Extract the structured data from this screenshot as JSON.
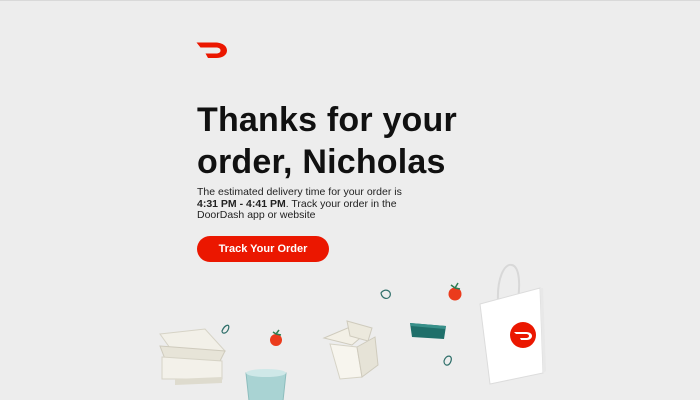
{
  "brand": {
    "logo_icon": "doordash-logo-icon",
    "accent_color": "#eb1700"
  },
  "email": {
    "headline": "Thanks for your order, Nicholas",
    "body_prefix": "The estimated delivery time for your order is ",
    "delivery_window": "4:31 PM - 4:41 PM",
    "body_suffix": ". Track your order in the DoorDash app or website",
    "cta_label": "Track Your Order"
  },
  "illustration": {
    "items": [
      "takeout-box-icon",
      "tomato-icon",
      "chinese-takeout-icon",
      "drink-cup-icon",
      "bowl-icon",
      "leaf-icon",
      "shopping-bag-icon"
    ]
  }
}
